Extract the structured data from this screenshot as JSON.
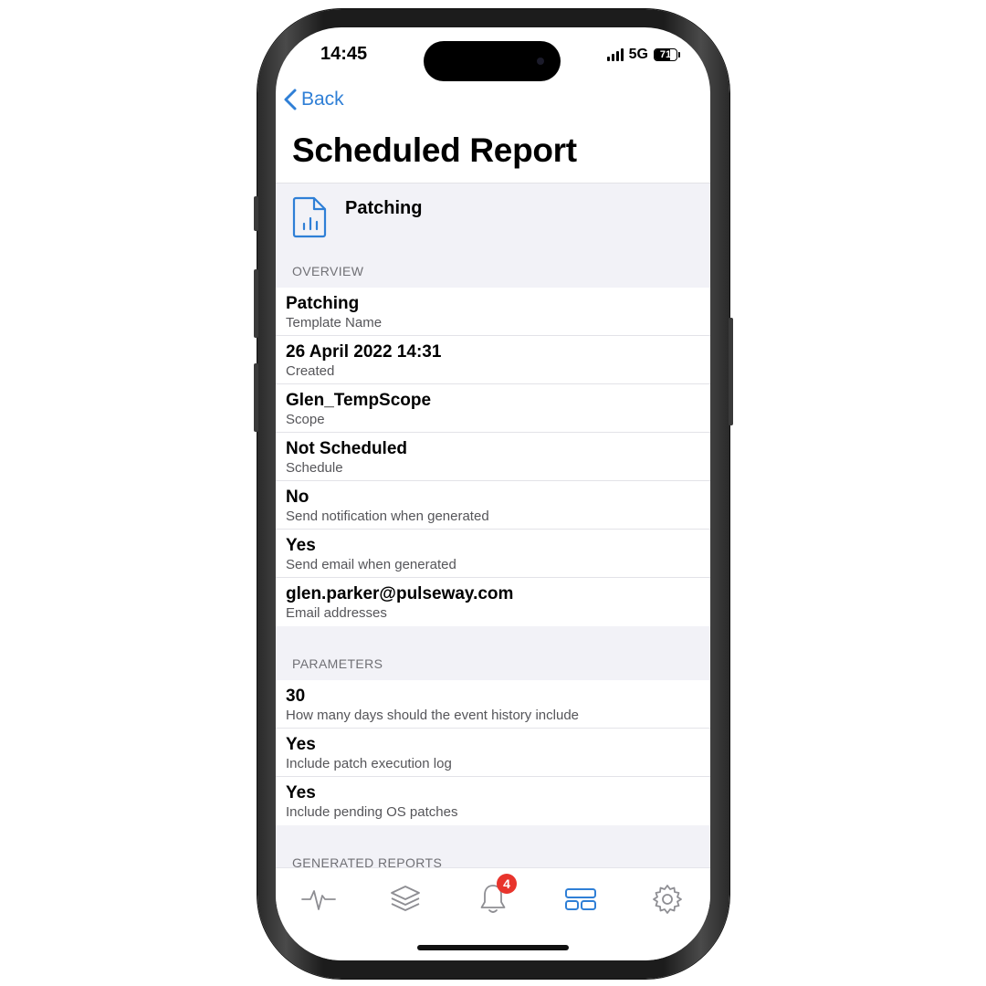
{
  "status_bar": {
    "time": "14:45",
    "network": "5G",
    "battery": "71",
    "battery_level": 0.71
  },
  "nav": {
    "back_label": "Back",
    "title": "Scheduled Report"
  },
  "report": {
    "name": "Patching",
    "icon": "report-document-icon"
  },
  "overview": {
    "section_title": "OVERVIEW",
    "rows": [
      {
        "value": "Patching",
        "label": "Template Name"
      },
      {
        "value": "26 April 2022 14:31",
        "label": "Created"
      },
      {
        "value": "Glen_TempScope",
        "label": "Scope"
      },
      {
        "value": "Not Scheduled",
        "label": "Schedule"
      },
      {
        "value": "No",
        "label": "Send notification when generated"
      },
      {
        "value": "Yes",
        "label": "Send email when generated"
      },
      {
        "value": "glen.parker@pulseway.com",
        "label": "Email addresses"
      }
    ]
  },
  "parameters": {
    "section_title": "PARAMETERS",
    "rows": [
      {
        "value": "30",
        "label": "How many days should the event history include"
      },
      {
        "value": "Yes",
        "label": "Include patch execution log"
      },
      {
        "value": "Yes",
        "label": "Include pending OS patches"
      }
    ]
  },
  "generated_reports": {
    "section_title": "GENERATED REPORTS"
  },
  "tab_bar": {
    "tabs": [
      {
        "icon": "activity-pulse-icon",
        "active": false
      },
      {
        "icon": "layers-icon",
        "active": false
      },
      {
        "icon": "bell-icon",
        "active": false,
        "badge": "4"
      },
      {
        "icon": "dashboard-icon",
        "active": true
      },
      {
        "icon": "gear-icon",
        "active": false
      }
    ],
    "active_color": "#2f7fd6",
    "inactive_color": "#8e8e93"
  }
}
